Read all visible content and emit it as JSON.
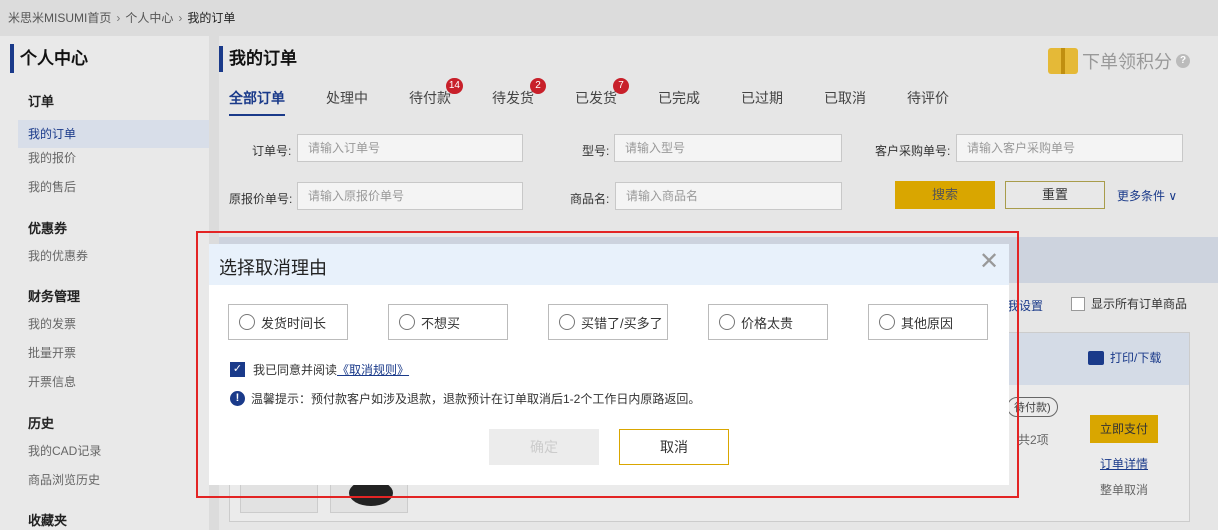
{
  "breadcrumb": {
    "home": "米思米MISUMI首页",
    "personal": "个人中心",
    "current": "我的订单"
  },
  "sidebar": {
    "title": "个人中心",
    "sections": {
      "order": {
        "label": "订单",
        "items": [
          "我的订单",
          "我的报价",
          "我的售后"
        ]
      },
      "coupon": {
        "label": "优惠券",
        "items": [
          "我的优惠券"
        ]
      },
      "finance": {
        "label": "财务管理",
        "items": [
          "我的发票",
          "批量开票",
          "开票信息"
        ]
      },
      "history": {
        "label": "历史",
        "items": [
          "我的CAD记录",
          "商品浏览历史"
        ]
      },
      "favorites": {
        "label": "收藏夹"
      }
    }
  },
  "main": {
    "title": "我的订单",
    "points_label": "下单领积分",
    "tabs": [
      {
        "label": "全部订单",
        "badge": null
      },
      {
        "label": "处理中",
        "badge": null
      },
      {
        "label": "待付款",
        "badge": "14"
      },
      {
        "label": "待发货",
        "badge": "2"
      },
      {
        "label": "已发货",
        "badge": "7"
      },
      {
        "label": "已完成",
        "badge": null
      },
      {
        "label": "已过期",
        "badge": null
      },
      {
        "label": "已取消",
        "badge": null
      },
      {
        "label": "待评价",
        "badge": null
      }
    ],
    "filters": {
      "order_no_label": "订单号:",
      "order_no_placeholder": "请输入订单号",
      "model_label": "型号:",
      "model_placeholder": "请输入型号",
      "po_label": "客户采购单号:",
      "po_placeholder": "请输入客户采购单号",
      "quote_label": "原报价单号:",
      "quote_placeholder": "请输入原报价单号",
      "product_label": "商品名:",
      "product_placeholder": "请输入商品名",
      "search_label": "搜索",
      "reset_label": "重置",
      "more_label": "更多条件"
    },
    "list_settings_partial": "我设置",
    "show_all_label": "显示所有订单商品",
    "order_card": {
      "print_label": "打印/下载",
      "status_partial": "待付款)",
      "count_partial": "共2项",
      "pay_label": "立即支付",
      "detail_label": "订单详情",
      "cancel_all_label": "整单取消"
    }
  },
  "dialog": {
    "title": "选择取消理由",
    "reasons": [
      "发货时间长",
      "不想买",
      "买错了/买多了",
      "价格太贵",
      "其他原因"
    ],
    "agree_text": "我已同意并阅读",
    "agree_link": "《取消规则》",
    "tip": "温馨提示：预付款客户如涉及退款，退款预计在订单取消后1-2个工作日内原路返回。",
    "confirm_label": "确定",
    "cancel_label": "取消"
  },
  "colors": {
    "accent": "#1a3a8a",
    "primary_button": "#d9a600",
    "badge": "#c8202a",
    "highlight_frame": "#e32424"
  }
}
